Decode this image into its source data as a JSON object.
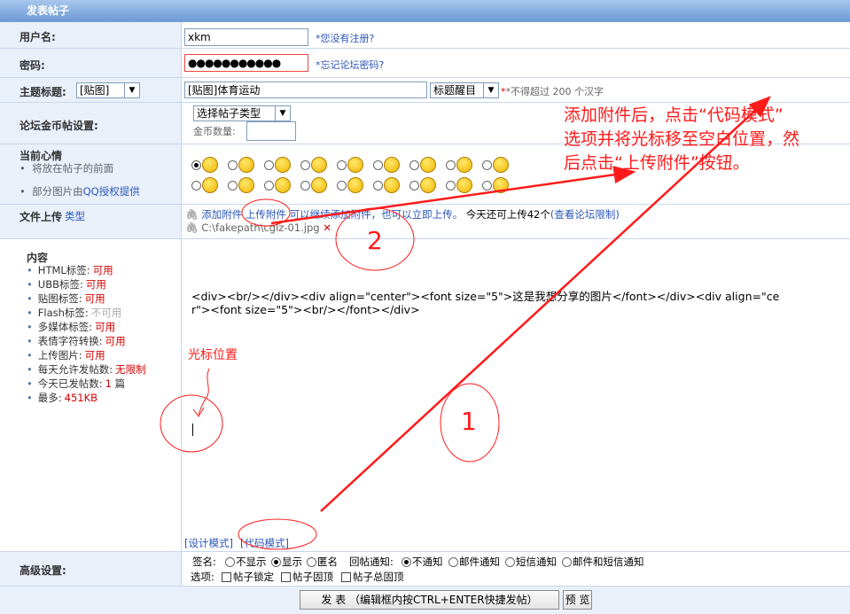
{
  "header": {
    "title": "发表帖子"
  },
  "username": {
    "label": "用户名:",
    "value": "xkm",
    "hint": "*您没有注册?"
  },
  "password": {
    "label": "密码:",
    "masked": "●●●●●●●●●●●",
    "hint": "*忘记论坛密码?"
  },
  "subject": {
    "label": "主题标题:",
    "prefix_select": "[贴图]",
    "value": "[贴图]体育运动",
    "style_select": "标题醒目",
    "hint": "*不得超过 200 个汉字"
  },
  "gold": {
    "label": "论坛金币帖设置:",
    "type_select": "选择帖子类型",
    "amount_label": "金币数量:"
  },
  "mood": {
    "label": "当前心情",
    "note1": "将放在帖子的前面",
    "note2_prefix": "部分图片由",
    "note2_link": "QQ授权提供"
  },
  "upload": {
    "label": "文件上传",
    "type_link": "类型",
    "add_link": "添加附件",
    "upload_link": "上传附件",
    "continue_text": "可以继续添加附件，也可以立即上传。",
    "quota_text": "今天还可上传42个",
    "quota_link": "(查看论坛限制)",
    "file_path": "C:\\fakepath\\cglz-01.jpg"
  },
  "content": {
    "label": "内容",
    "permissions": [
      {
        "name": "HTML标签:",
        "value": "可用"
      },
      {
        "name": "UBB标签:",
        "value": "可用"
      },
      {
        "name": "贴图标签:",
        "value": "可用"
      },
      {
        "name": "Flash标签:",
        "value": "不可用"
      },
      {
        "name": "多媒体标签:",
        "value": "可用"
      },
      {
        "name": "表情字符转换:",
        "value": "可用"
      },
      {
        "name": "上传图片:",
        "value": "可用"
      },
      {
        "name": "每天允许发帖数:",
        "value": "无限制"
      },
      {
        "name": "今天已发帖数:",
        "value": "1",
        "suffix": " 篇"
      },
      {
        "name": "最多:",
        "value": "451KB"
      }
    ],
    "code_line1": "<div><br/></div><div align=\"center\"><font size=\"5\">这是我想分享的图片</font></div><div align=\"ce",
    "code_line2": "r\"><font size=\"5\"><br/></font></div>",
    "design_mode": "[设计模式]",
    "code_mode": "[代码模式]"
  },
  "advanced": {
    "label": "高级设置:",
    "signature_label": "签名:",
    "signature_options": [
      "不显示",
      "显示",
      "匿名"
    ],
    "signature_selected": 1,
    "notify_label": "回帖通知:",
    "notify_options": [
      "不通知",
      "邮件通知",
      "短信通知",
      "邮件和短信通知"
    ],
    "notify_selected": 0,
    "options_label": "选项:",
    "options": [
      "帖子锁定",
      "帖子固顶",
      "帖子总固顶"
    ]
  },
  "buttons": {
    "submit": "发 表 （编辑框内按CTRL+ENTER快捷发帖）",
    "preview": "预 览"
  },
  "annotations": {
    "instruction_line1": "添加附件后，点击“代码模式”",
    "instruction_line2": "选项并将光标移至空白位置，然",
    "instruction_line3": "后点击“上传附件”按钮。",
    "cursor_label": "光标位置",
    "step1": "1",
    "step2": "2",
    "color": "#ff1a1a"
  }
}
